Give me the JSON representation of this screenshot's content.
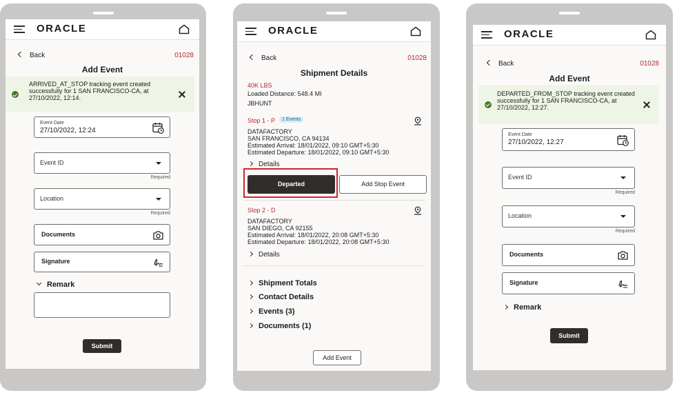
{
  "app": {
    "logo": "ORACLE"
  },
  "panel1": {
    "back_label": "Back",
    "ref": "01028",
    "title": "Add Event",
    "toast": "ARRIVED_AT_STOP tracking event created successfully for 1 SAN FRANCISCO-CA, at 27/10/2022, 12:14.",
    "event_date_label": "Event Date",
    "event_date_value": "27/10/2022, 12:24",
    "event_id_label": "Event ID",
    "location_label": "Location",
    "required": "Required",
    "documents_label": "Documents",
    "signature_label": "Signature",
    "remark_label": "Remark",
    "submit_label": "Submit"
  },
  "panel2": {
    "back_label": "Back",
    "ref": "01028",
    "title": "Shipment Details",
    "weight": "40K LBS",
    "loaded_distance": "Loaded Distance: 548.4 MI",
    "carrier": "JBHUNT",
    "stop1": {
      "title": "Stop 1 - P",
      "badge": "1 Events",
      "name": "DATAFACTORY",
      "address": "SAN FRANCISCO, CA 94134",
      "arrival": "Estimated Arrival: 18/01/2022, 09:10 GMT+5:30",
      "departure": "Estimated Departure: 18/01/2022, 09:10 GMT+5:30",
      "details": "Details",
      "departed_button": "Departed",
      "add_stop_event_button": "Add Stop Event"
    },
    "stop2": {
      "title": "Stop 2 - D",
      "name": "DATAFACTORY",
      "address": "SAN DIEGO, CA 92155",
      "arrival": "Estimated Arrival: 18/01/2022, 20:08 GMT+5:30",
      "departure": "Estimated Departure: 18/01/2022, 20:08 GMT+5:30",
      "details": "Details"
    },
    "sections": [
      "Shipment Totals",
      "Contact Details",
      "Events (3)",
      "Documents (1)"
    ],
    "add_event_button": "Add Event"
  },
  "panel3": {
    "back_label": "Back",
    "ref": "01028",
    "title": "Add Event",
    "toast": "DEPARTED_FROM_STOP tracking event created successfully for 1 SAN FRANCISCO-CA, at 27/10/2022, 12:27.",
    "event_date_label": "Event Date",
    "event_date_value": "27/10/2022, 12:27",
    "event_id_label": "Event ID",
    "location_label": "Location",
    "required": "Required",
    "documents_label": "Documents",
    "signature_label": "Signature",
    "remark_label": "Remark",
    "submit_label": "Submit"
  },
  "colors": {
    "accent_red": "#b3282d",
    "button_dark": "#312d2a",
    "success_bg": "#eef5e6",
    "frame": "#c9c8c7"
  }
}
